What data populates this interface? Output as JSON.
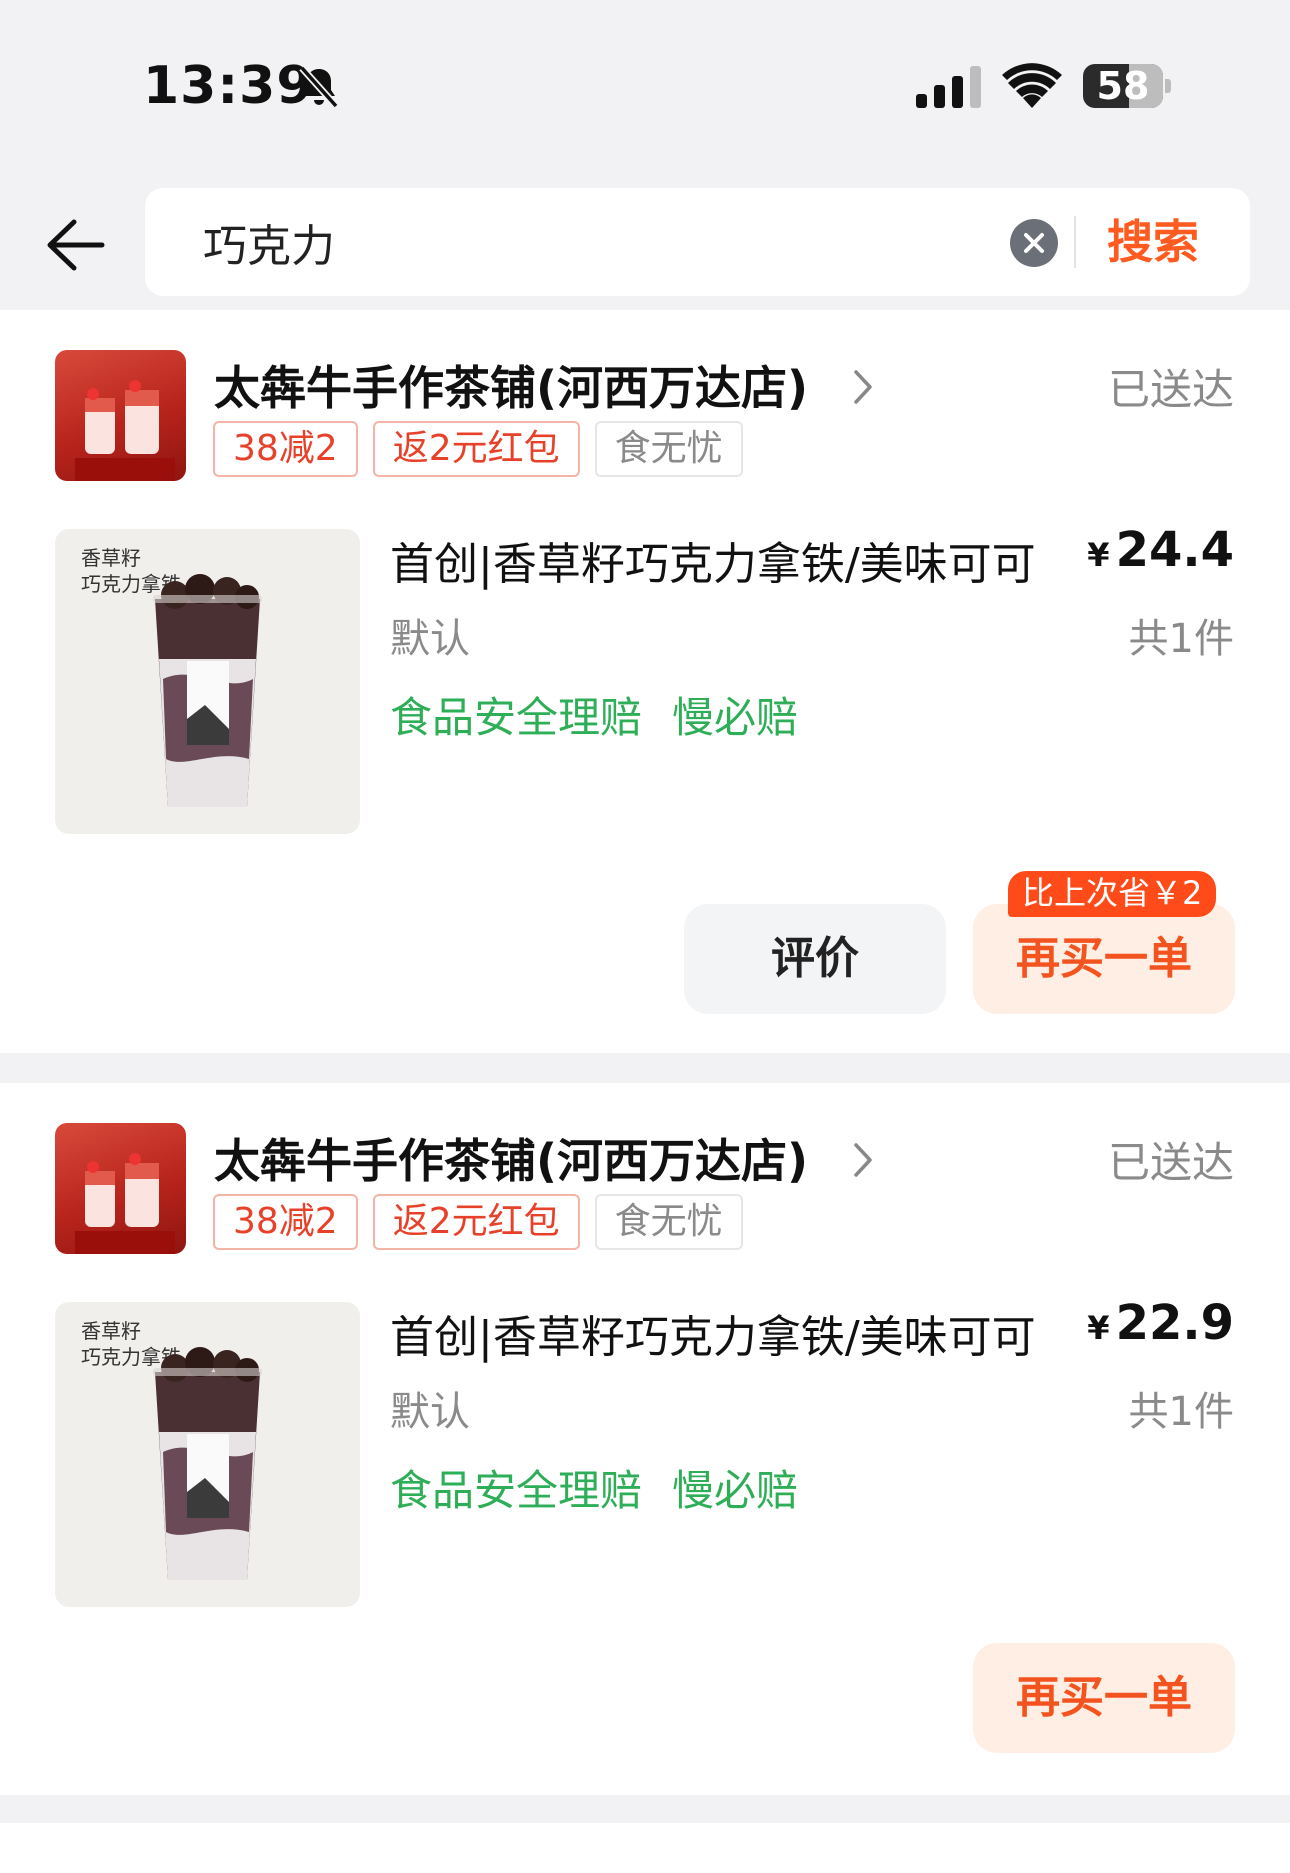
{
  "status_bar": {
    "time": "13:39",
    "battery_percent": 58,
    "battery_label": "58",
    "icons": [
      "bell-slash-icon",
      "signal-icon",
      "wifi-icon",
      "battery-icon"
    ]
  },
  "search": {
    "query": "巧克力",
    "button_label": "搜索",
    "icons": [
      "back-arrow-icon",
      "clear-icon"
    ]
  },
  "orders": [
    {
      "store_name": "太犇牛手作茶铺(河西万达店)",
      "status": "已送达",
      "tags": [
        "38减2",
        "返2元红包",
        "食无忧"
      ],
      "product": {
        "title": "首创|香草籽巧克力拿铁/美味可可",
        "variant": "默认",
        "currency": "¥",
        "price": "24.4",
        "quantity": "共1件",
        "guarantees": [
          "食品安全理赔",
          "慢必赔"
        ],
        "image_text": [
          "香草籽",
          "巧克力拿铁"
        ]
      },
      "review_label": "评价",
      "rebuy_label": "再买一单",
      "saving_badge": "比上次省￥2"
    },
    {
      "store_name": "太犇牛手作茶铺(河西万达店)",
      "status": "已送达",
      "tags": [
        "38减2",
        "返2元红包",
        "食无忧"
      ],
      "product": {
        "title": "首创|香草籽巧克力拿铁/美味可可",
        "variant": "默认",
        "currency": "¥",
        "price": "22.9",
        "quantity": "共1件",
        "guarantees": [
          "食品安全理赔",
          "慢必赔"
        ],
        "image_text": [
          "香草籽",
          "巧克力拿铁"
        ]
      },
      "rebuy_label": "再买一单"
    }
  ],
  "colors": {
    "accent": "#ff5a1f",
    "tag_red": "#e8412a",
    "guarantee_green": "#2fae58",
    "background": "#f2f2f4"
  }
}
